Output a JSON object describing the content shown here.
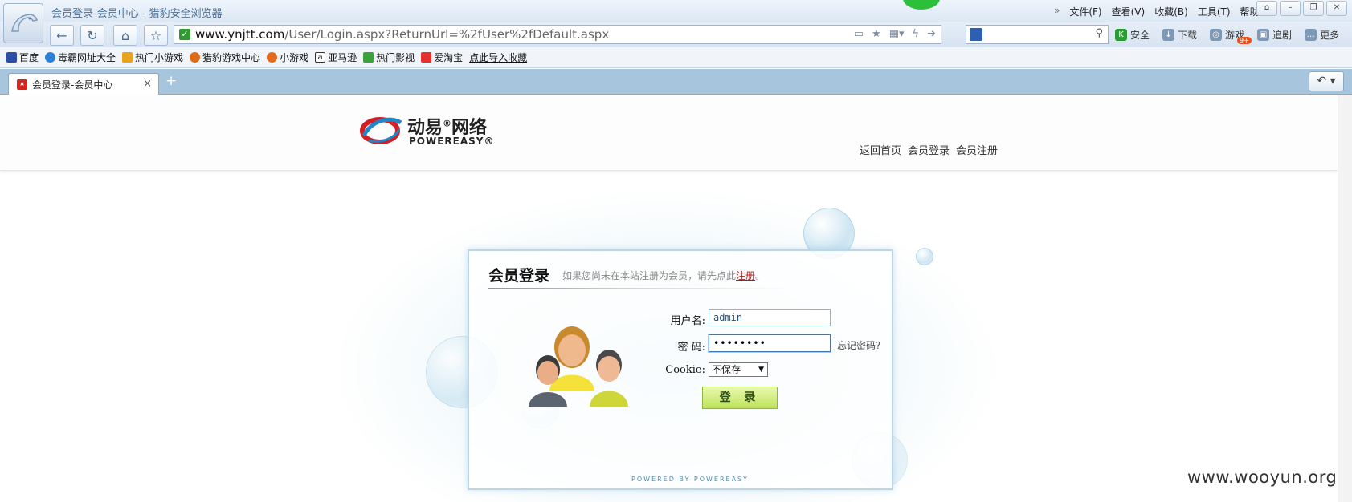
{
  "window": {
    "title": "会员登录-会员中心 - 猎豹安全浏览器",
    "menus": [
      "文件(F)",
      "查看(V)",
      "收藏(B)",
      "工具(T)",
      "帮助"
    ],
    "nav_chevron": "»"
  },
  "address_bar": {
    "url_host": "www.ynjtt.com",
    "url_path": "/User/Login.aspx?ReturnUrl=%2fUser%2fDefault.aspx"
  },
  "toolbar": {
    "security": "安全",
    "download": "下载",
    "games": "游戏",
    "games_badge": "9+",
    "drama": "追剧",
    "more": "更多"
  },
  "favorites": [
    {
      "label": "百度",
      "icon": "baidu-icon",
      "color": "#2b4ea8"
    },
    {
      "label": "毒霸网址大全",
      "icon": "duba-icon",
      "color": "#2a7fd6"
    },
    {
      "label": "热门小游戏",
      "icon": "game-icon",
      "color": "#e9a21b"
    },
    {
      "label": "猎豹游戏中心",
      "icon": "liebao-game-icon",
      "color": "#e06b16"
    },
    {
      "label": "小游戏",
      "icon": "small-game-icon",
      "color": "#e36a1e"
    },
    {
      "label": "亚马逊",
      "icon": "amazon-icon",
      "color": "#333333"
    },
    {
      "label": "热门影视",
      "icon": "video-icon",
      "color": "#3ca13c"
    },
    {
      "label": "爱淘宝",
      "icon": "taobao-icon",
      "color": "#e5312e"
    }
  ],
  "import_favorites": "点此导入收藏",
  "tabs": [
    {
      "label": "会员登录-会员中心",
      "close": "×"
    }
  ],
  "new_tab": "+",
  "site": {
    "brand_cn": "动易",
    "brand_cn2": "网络",
    "brand_en": "POWEREASY",
    "reg_mark": "®",
    "top_links": [
      "返回首页",
      "会员登录",
      "会员注册"
    ]
  },
  "login": {
    "title": "会员登录",
    "hint_prefix": "如果您尚未在本站注册为会员，请先点此",
    "hint_link": "注册",
    "hint_suffix": "。",
    "username_label": "用户名:",
    "username_value": "admin",
    "password_label": "密  码:",
    "password_value": "••••••••",
    "forgot": "忘记密码?",
    "cookie_label": "Cookie:",
    "cookie_value": "不保存",
    "submit": "登 录",
    "powered": "POWERED BY POWEREASY"
  },
  "watermark": "www.wooyun.org",
  "colors": {
    "accent": "#a8c5de",
    "submit_green": "#bde35a",
    "link_red": "#b01b1b"
  }
}
